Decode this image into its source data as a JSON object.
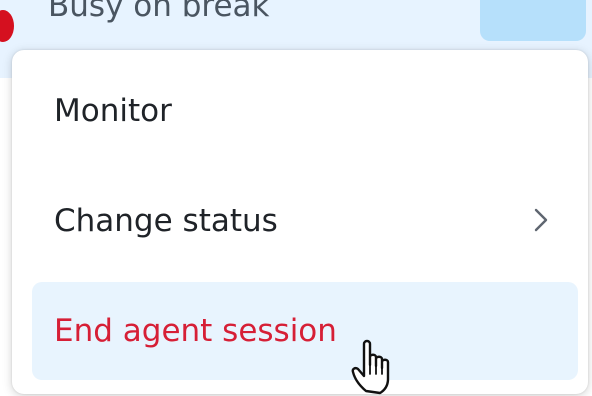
{
  "status": {
    "text": "Busy on break",
    "dot_color": "#d5101f",
    "dot_icon": "status-dot-icon"
  },
  "menu": {
    "items": [
      {
        "label": "Monitor"
      },
      {
        "label": "Change status",
        "icon": "chevron-right-icon"
      },
      {
        "label": "End agent session",
        "color": "#d61f36"
      }
    ]
  },
  "cursor": {
    "icon": "hand-pointer-icon"
  }
}
